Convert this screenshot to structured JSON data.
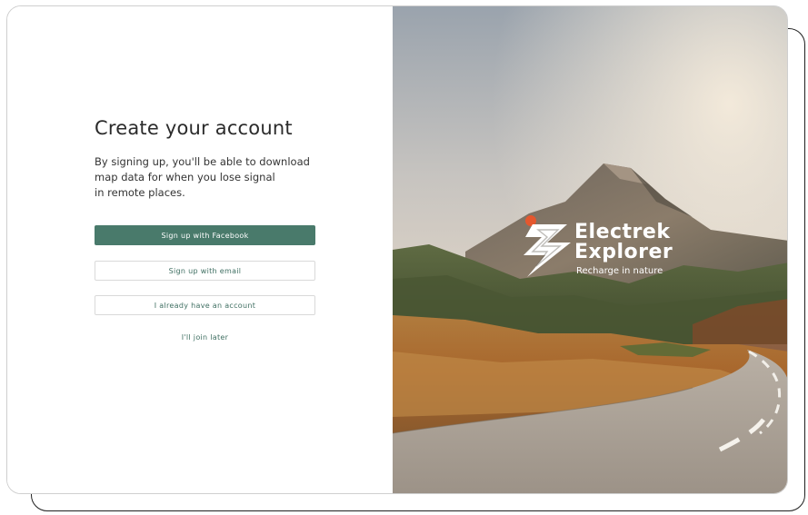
{
  "signup": {
    "title": "Create your account",
    "description_lines": [
      "By signing up, you'll be able to download",
      "map data for when you lose signal",
      "in remote places."
    ],
    "buttons": {
      "facebook": "Sign up with Facebook",
      "email": "Sign up with email",
      "existing_account": "I already have an account"
    },
    "skip_link": "I'll join later"
  },
  "brand": {
    "name_line_1": "Electrek",
    "name_line_2": "Explorer",
    "tagline": "Recharge in nature"
  },
  "colors": {
    "primary_green": "#497a6b",
    "accent_orange": "#e4572e",
    "text_dark": "#2b2b2b"
  },
  "icons": {
    "logo": "electrek-explorer-zigzag-mark"
  }
}
